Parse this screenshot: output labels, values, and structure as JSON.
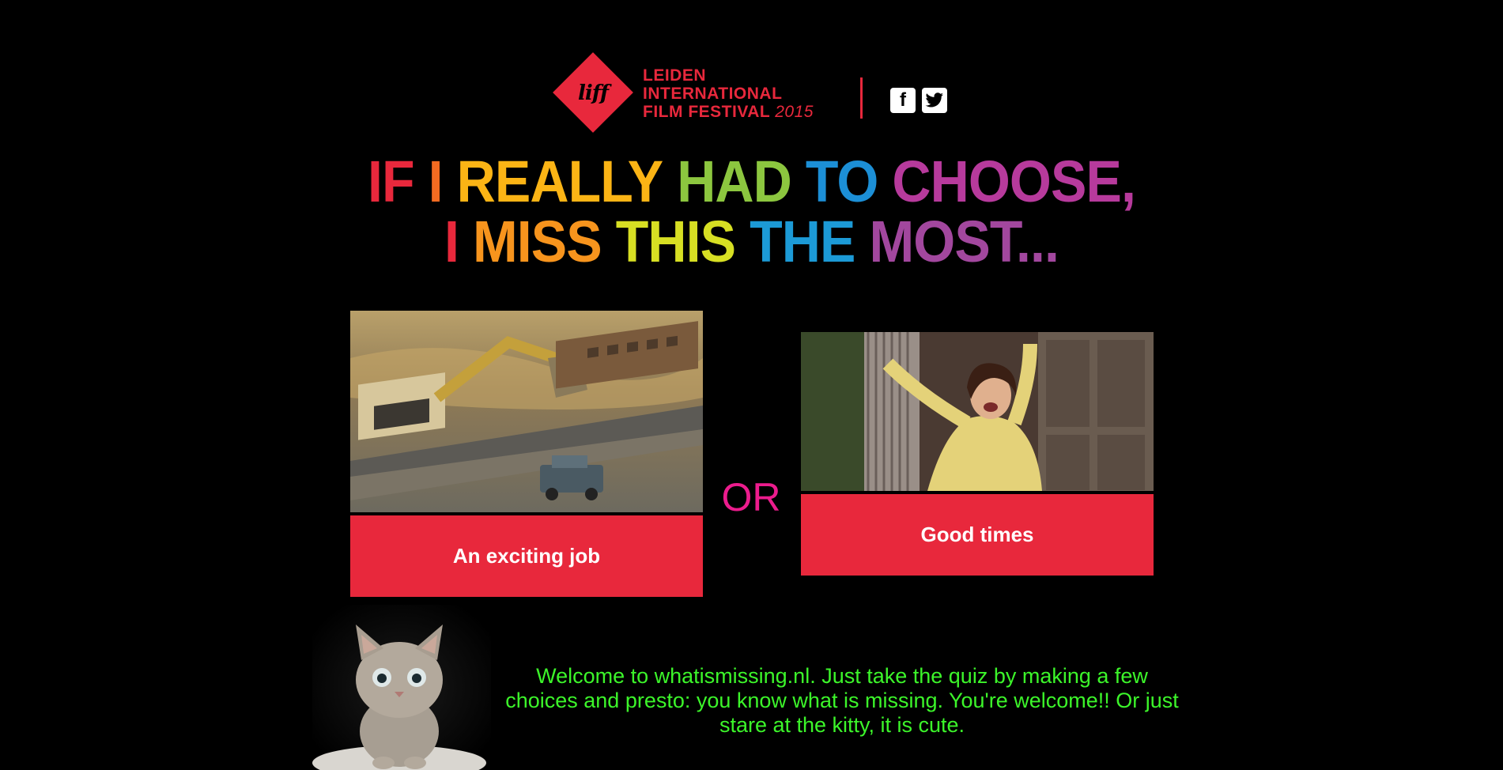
{
  "header": {
    "logo_mark": "liff",
    "logo_lines": [
      "LEIDEN",
      "INTERNATIONAL",
      "FILM FESTIVAL"
    ],
    "logo_year": "2015",
    "social": [
      {
        "name": "facebook",
        "glyph": "f",
        "icon": "facebook-icon"
      },
      {
        "name": "twitter",
        "glyph": "t",
        "icon": "twitter-icon"
      }
    ]
  },
  "title": {
    "line1": [
      "IF",
      "I",
      "REALLY",
      "HAD",
      "TO",
      "CHOOSE,"
    ],
    "line2": [
      "I",
      "MISS",
      "THIS",
      "THE",
      "MOST..."
    ]
  },
  "colors": {
    "brand_red": "#e8283c",
    "or_pink": "#ec1c8d",
    "welcome_green": "#3cf52a",
    "background": "#000000"
  },
  "choices": {
    "a": {
      "label": "An exciting job",
      "image": "excavator-on-train-gif"
    },
    "b": {
      "label": "Good times",
      "image": "dancing-woman-gif"
    }
  },
  "or_text": "OR",
  "welcome_text": "Welcome to whatismissing.nl. Just take the quiz by making a few choices and presto: you know what is missing. You're welcome!! Or just stare at the kitty, it is cute.",
  "kitty_image": "kitten-photo"
}
